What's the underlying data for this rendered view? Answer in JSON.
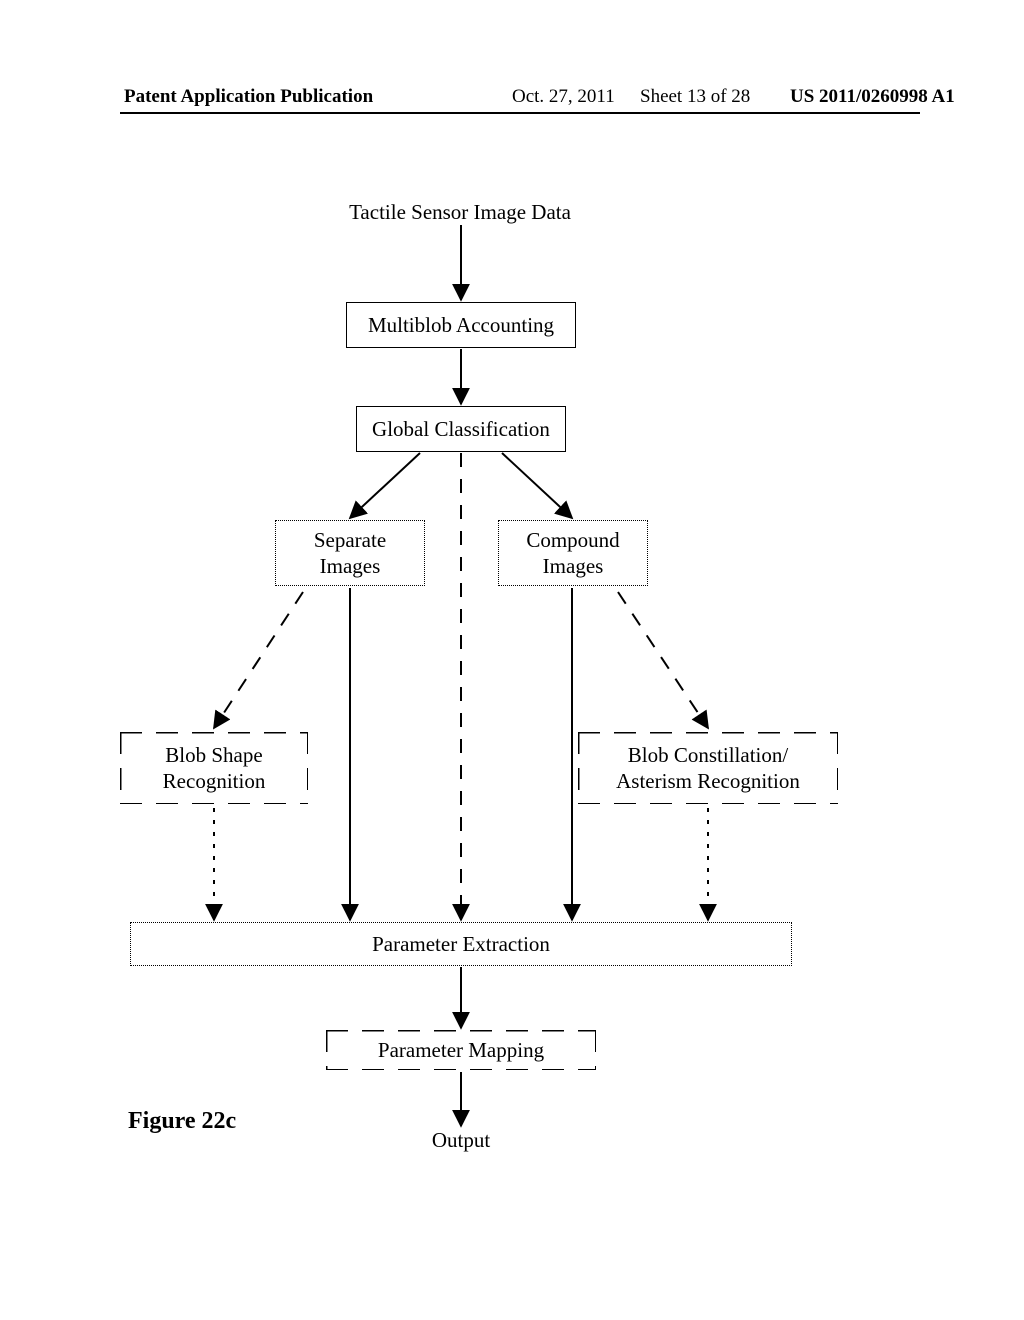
{
  "header": {
    "left": "Patent Application Publication",
    "date": "Oct. 27, 2011",
    "sheet": "Sheet 13 of 28",
    "pubno": "US 2011/0260998 A1"
  },
  "diagram": {
    "input_label": "Tactile Sensor Image Data",
    "multiblob": "Multiblob Accounting",
    "global_class": "Global Classification",
    "sep_images": "Separate\nImages",
    "comp_images": "Compound\nImages",
    "blob_shape": "Blob Shape\nRecognition",
    "blob_const": "Blob Constillation/\nAsterism Recognition",
    "param_extract": "Parameter Extraction",
    "param_map": "Parameter Mapping",
    "output_label": "Output",
    "figure_label": "Figure 22c"
  }
}
